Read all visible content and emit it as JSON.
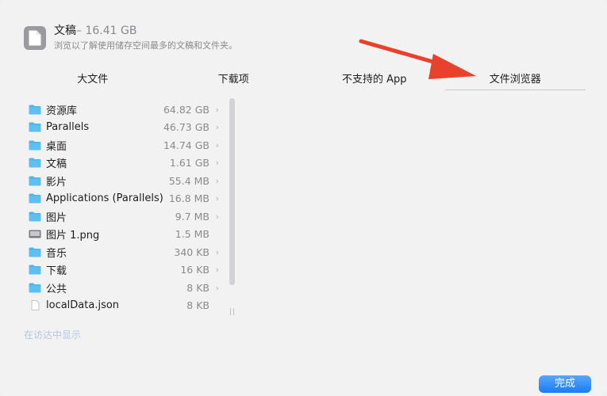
{
  "header": {
    "title": "文稿",
    "size": "– 16.41 GB",
    "subtitle": "浏览以了解使用储存空间最多的文稿和文件夹。"
  },
  "tabs": [
    {
      "label": "大文件"
    },
    {
      "label": "下载项"
    },
    {
      "label": "不支持的 App"
    },
    {
      "label": "文件浏览器"
    }
  ],
  "items": [
    {
      "name": "资源库",
      "size": "64.82 GB",
      "icon": "folder-icon",
      "chevron": "›"
    },
    {
      "name": "Parallels",
      "size": "46.73 GB",
      "icon": "folder-icon",
      "chevron": "›"
    },
    {
      "name": "桌面",
      "size": "14.74 GB",
      "icon": "desktop-folder-icon",
      "chevron": "›"
    },
    {
      "name": "文稿",
      "size": "1.61 GB",
      "icon": "documents-folder-icon",
      "chevron": "›"
    },
    {
      "name": "影片",
      "size": "55.4 MB",
      "icon": "movies-folder-icon",
      "chevron": "›"
    },
    {
      "name": "Applications (Parallels)",
      "size": "16.8 MB",
      "icon": "applications-folder-icon",
      "chevron": "›"
    },
    {
      "name": "图片",
      "size": "9.7 MB",
      "icon": "pictures-folder-icon",
      "chevron": "›"
    },
    {
      "name": "图片 1.png",
      "size": "1.5 MB",
      "icon": "image-file-icon",
      "chevron": ""
    },
    {
      "name": "音乐",
      "size": "340 KB",
      "icon": "music-folder-icon",
      "chevron": "›"
    },
    {
      "name": "下载",
      "size": "16 KB",
      "icon": "downloads-folder-icon",
      "chevron": "›"
    },
    {
      "name": "公共",
      "size": "8 KB",
      "icon": "public-folder-icon",
      "chevron": "›"
    },
    {
      "name": "localData.json",
      "size": "8 KB",
      "icon": "json-file-icon",
      "chevron": ""
    }
  ],
  "show_in_finder": "在访达中显示",
  "done_label": "完成",
  "resize_glyph": "||",
  "colors": {
    "accent": "#1a7cf5",
    "folder": "#4fb5ec",
    "arrow": "#e8412c"
  }
}
